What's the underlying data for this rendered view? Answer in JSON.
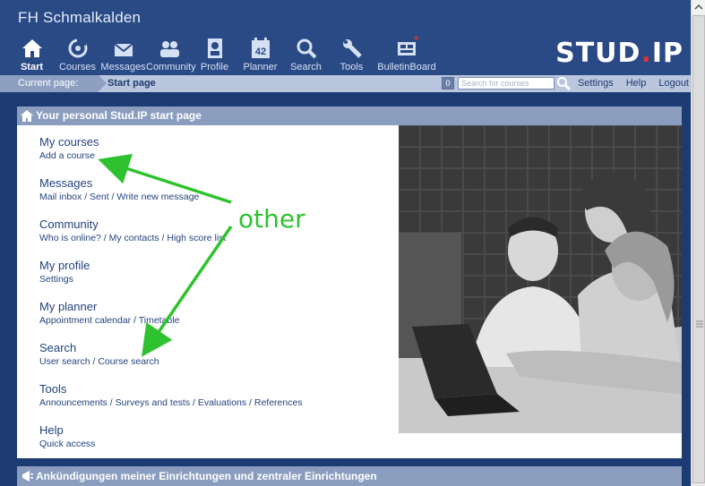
{
  "site": {
    "title": "FH Schmalkalden",
    "logo_main": "STUD",
    "logo_dot": ".",
    "logo_suffix": "IP"
  },
  "nav": [
    {
      "label": "Start",
      "icon": "home-icon",
      "active": true
    },
    {
      "label": "Courses",
      "icon": "courses-icon"
    },
    {
      "label": "Messages",
      "icon": "mail-icon"
    },
    {
      "label": "Community",
      "icon": "community-icon"
    },
    {
      "label": "Profile",
      "icon": "profile-icon"
    },
    {
      "label": "Planner",
      "icon": "calendar-icon",
      "badge": "42"
    },
    {
      "label": "Search",
      "icon": "search-icon"
    },
    {
      "label": "Tools",
      "icon": "wrench-icon"
    },
    {
      "label": "BulletinBoard",
      "icon": "bulletin-board-icon"
    }
  ],
  "breadcrumb": {
    "label": "Current page:",
    "page": "Start page"
  },
  "counter": "0",
  "search": {
    "placeholder": "Search for courses"
  },
  "toplinks": [
    "Settings",
    "Help",
    "Logout"
  ],
  "panel": {
    "title": "Your personal Stud.IP start page",
    "groups": [
      {
        "title": "My courses",
        "subs": "Add a course"
      },
      {
        "title": "Messages",
        "subs": "Mail inbox / Sent / Write new message"
      },
      {
        "title": "Community",
        "subs": "Who is online? / My contacts / High score list"
      },
      {
        "title": "My profile",
        "subs": "Settings"
      },
      {
        "title": "My planner",
        "subs": "Appointment calendar / Timetable"
      },
      {
        "title": "Search",
        "subs": "User search / Course search"
      },
      {
        "title": "Tools",
        "subs": "Announcements / Surveys and tests / Evaluations / References"
      },
      {
        "title": "Help",
        "subs": "Quick access"
      }
    ]
  },
  "panel2": {
    "title": "Ankündigungen meiner Einrichtungen und zentraler Einrichtungen"
  },
  "annotation": {
    "text": "other",
    "color": "#2fc22f"
  },
  "colors": {
    "header": "#2a4a86",
    "page_bg": "#1c3b72",
    "panel_head": "#8b9dbf",
    "link": "#24437f"
  }
}
